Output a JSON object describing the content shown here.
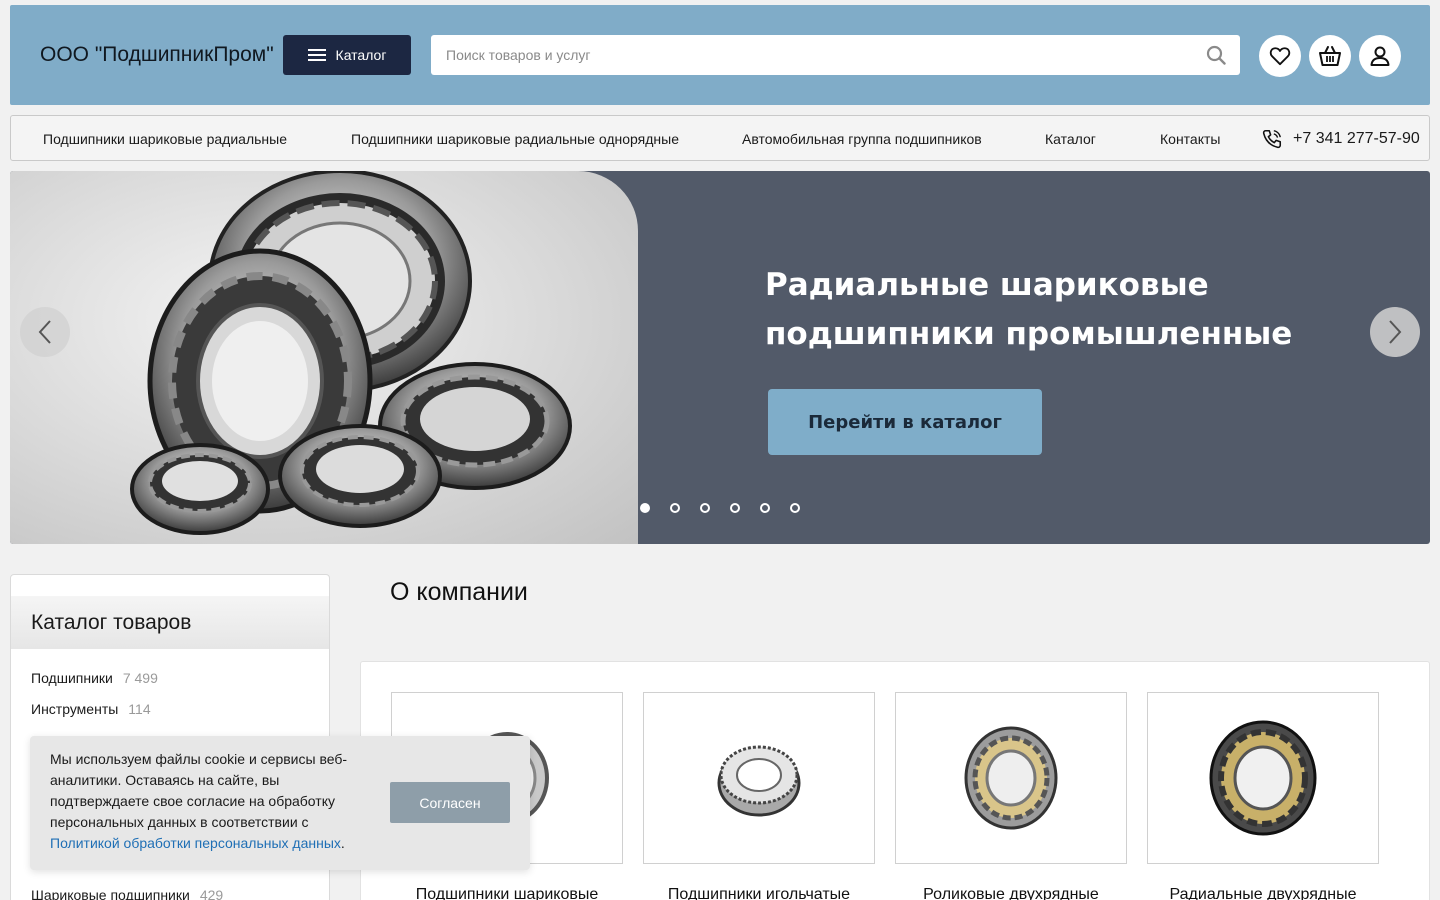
{
  "header": {
    "company_name": "ООО \"ПодшипникПром\"",
    "catalog_label": "Каталог",
    "search_placeholder": "Поиск товаров и услуг"
  },
  "icons": {
    "burger": "menu-icon",
    "search": "search-icon",
    "favorites": "heart-icon",
    "cart": "basket-icon",
    "account": "user-icon",
    "phone": "phone-icon",
    "prev": "chevron-left-icon",
    "next": "chevron-right-icon"
  },
  "nav": {
    "items": [
      "Подшипники шариковые радиальные",
      "Подшипники шариковые радиальные однорядные",
      "Автомобильная группа подшипников",
      "Каталог",
      "Контакты"
    ],
    "phone": "+7 341 277-57-90"
  },
  "banner": {
    "title_line1": "Радиальные шариковые",
    "title_line2": "подшипники промышленные",
    "button_label": "Перейти в каталог",
    "slide_count": 6,
    "active_slide": 1
  },
  "sidebar": {
    "title": "Каталог товаров",
    "items": [
      {
        "label": "Подшипники",
        "count": "7 499"
      },
      {
        "label": "Инструменты",
        "count": "114"
      },
      {
        "label": "Шариковые подшипники",
        "count": "429"
      }
    ]
  },
  "main": {
    "about_title": "О компании",
    "products": [
      {
        "title": "Подшипники шариковые"
      },
      {
        "title": "Подшипники игольчатые"
      },
      {
        "title": "Роликовые двухрядные"
      },
      {
        "title": "Радиальные двухрядные"
      }
    ]
  },
  "cookie": {
    "text": "Мы используем файлы cookie и сервисы веб-аналитики. Оставаясь на сайте, вы подтверждаете свое согласие на обработку персональных данных в соответствии с ",
    "link_text": "Политикой обработки персональных данных",
    "text_end": ".",
    "accept_label": "Согласен"
  },
  "colors": {
    "header_bg": "#80acc8",
    "catalog_btn": "#1c2742",
    "banner_bg": "#525a69",
    "accent_button": "#7fadc9",
    "cookie_button": "#8e9ea9",
    "link": "#1f6fb5"
  }
}
